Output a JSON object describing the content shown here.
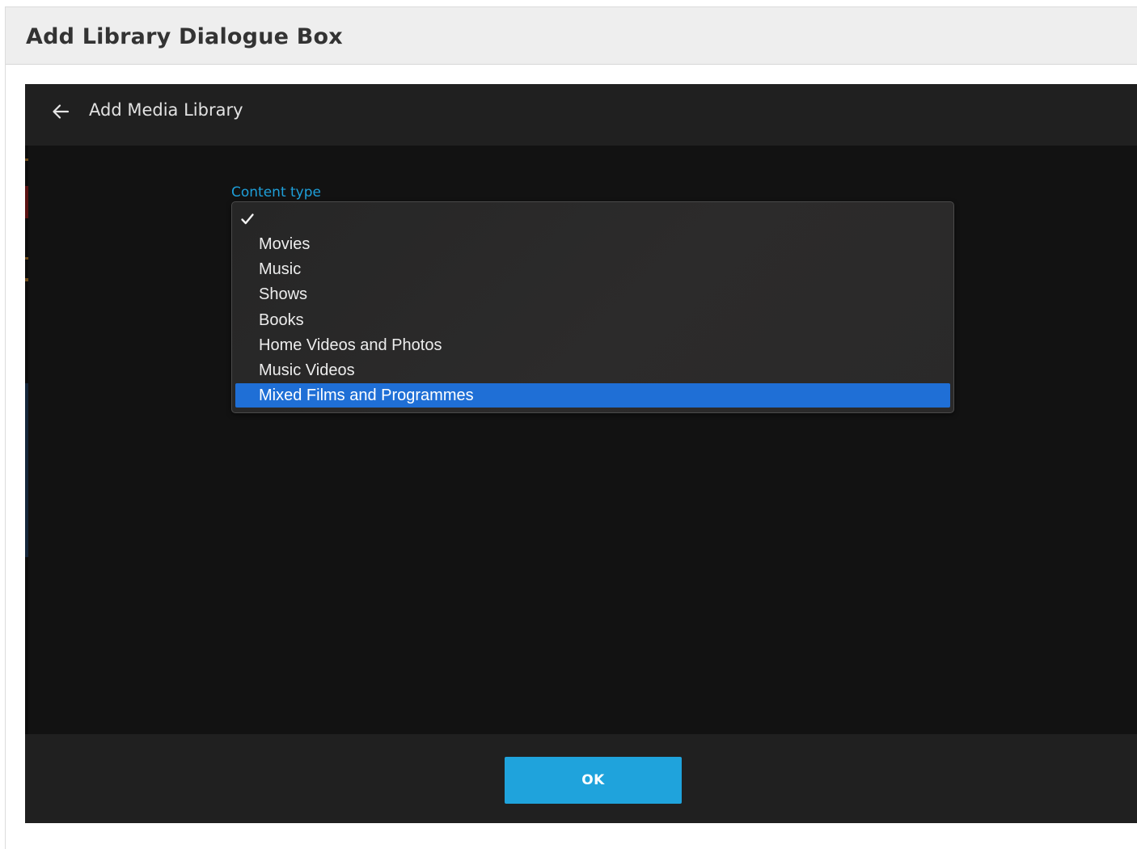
{
  "document": {
    "title": "Add Library Dialogue Box"
  },
  "app": {
    "header": {
      "back_icon": "arrow-left-icon",
      "title": "Add Media Library"
    },
    "content_type": {
      "label": "Content type",
      "check_icon": "checkmark-icon",
      "selected_value": "",
      "options": [
        "Movies",
        "Music",
        "Shows",
        "Books",
        "Home Videos and Photos",
        "Music Videos",
        "Mixed Films and Programmes"
      ],
      "highlighted_option": "Mixed Films and Programmes"
    },
    "footer": {
      "ok_label": "OK"
    }
  },
  "colors": {
    "accent": "#1fa3dc",
    "label_accent": "#1e9fd9",
    "highlight": "#1f6fd6",
    "background": "#121212",
    "bar": "#202020",
    "dropdown": "#2a2929"
  }
}
